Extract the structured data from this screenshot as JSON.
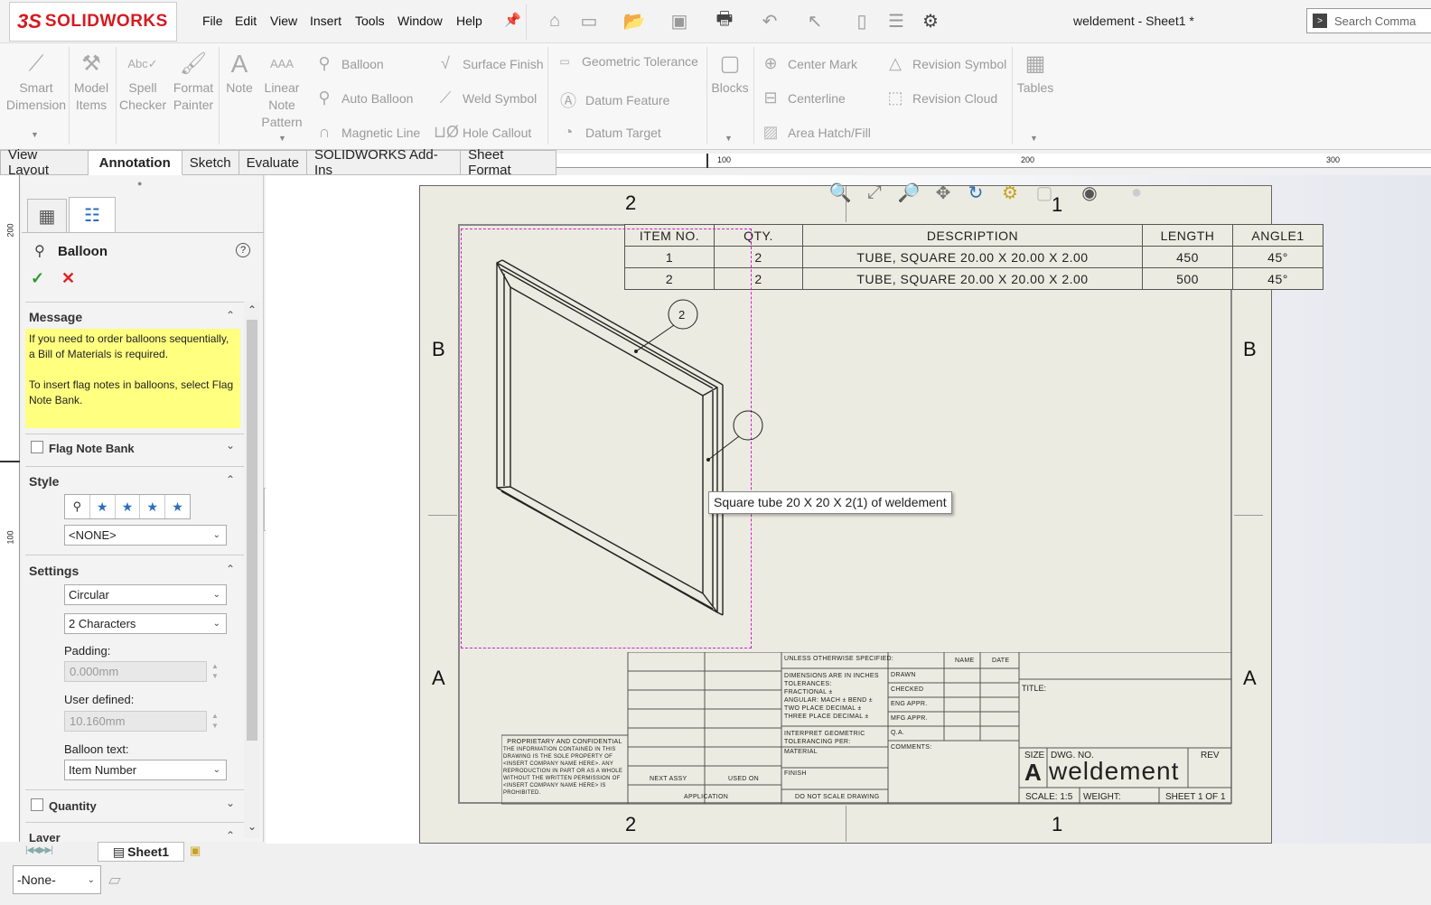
{
  "app": {
    "logo_ds": "3S",
    "logo_name": "SOLIDWORKS",
    "title": "weldement - Sheet1 *"
  },
  "menu": [
    "File",
    "Edit",
    "View",
    "Insert",
    "Tools",
    "Window",
    "Help"
  ],
  "search": {
    "placeholder": "Search Comma"
  },
  "ribbon": {
    "smart_dimension": [
      "Smart",
      "Dimension"
    ],
    "model_items": [
      "Model",
      "Items"
    ],
    "spell_checker": [
      "Spell",
      "Checker"
    ],
    "format_painter": [
      "Format",
      "Painter"
    ],
    "note": "Note",
    "linear_note_pattern": [
      "Linear",
      "Note",
      "Pattern"
    ],
    "balloon": "Balloon",
    "auto_balloon": "Auto Balloon",
    "magnetic_line": "Magnetic Line",
    "surface_finish": "Surface Finish",
    "weld_symbol": "Weld Symbol",
    "hole_callout": "Hole Callout",
    "geometric_tolerance": "Geometric Tolerance",
    "datum_feature": "Datum Feature",
    "datum_target": "Datum Target",
    "blocks": "Blocks",
    "center_mark": "Center Mark",
    "centerline": "Centerline",
    "area_hatch": "Area Hatch/Fill",
    "revision_symbol": "Revision Symbol",
    "revision_cloud": "Revision Cloud",
    "tables": "Tables"
  },
  "tabs": [
    "View Layout",
    "Annotation",
    "Sketch",
    "Evaluate",
    "SOLIDWORKS Add-Ins",
    "Sheet Format"
  ],
  "ruler": {
    "top": [
      "100",
      "200",
      "300"
    ],
    "left": [
      "200",
      "100"
    ]
  },
  "pm": {
    "title": "Balloon",
    "help": "?",
    "message_title": "Message",
    "message_1": "If you need to order balloons sequentially, a Bill of Materials is required.",
    "message_2": "To insert flag notes in balloons, select Flag Note Bank.",
    "flag_note_bank": "Flag Note Bank",
    "style_title": "Style",
    "style_value": "<NONE>",
    "settings_title": "Settings",
    "shape": "Circular",
    "size": "2 Characters",
    "padding_label": "Padding:",
    "padding_value": "0.000mm",
    "user_defined_label": "User defined:",
    "user_defined_value": "10.160mm",
    "balloon_text_label": "Balloon text:",
    "balloon_text_value": "Item Number",
    "quantity": "Quantity",
    "layer": "Layer"
  },
  "sheet_tab": "Sheet1",
  "status": {
    "layer": "-None-"
  },
  "drawing": {
    "zones_top": [
      "2",
      "1"
    ],
    "zones_side": [
      "B",
      "A"
    ],
    "bom_headers": [
      "ITEM NO.",
      "QTY.",
      "DESCRIPTION",
      "LENGTH",
      "ANGLE1"
    ],
    "bom_rows": [
      [
        "1",
        "2",
        "TUBE, SQUARE 20.00 X 20.00 X 2.00",
        "450",
        "45°"
      ],
      [
        "2",
        "2",
        "TUBE, SQUARE 20.00 X 20.00 X 2.00",
        "500",
        "45°"
      ]
    ],
    "balloon_1": "2",
    "tooltip": "Square tube 20 X 20 X 2(1) of weldement",
    "titleblock": {
      "unless": "UNLESS OTHERWISE SPECIFIED:",
      "name": "NAME",
      "date": "DATE",
      "dims": "DIMENSIONS ARE IN INCHES",
      "tol": "TOLERANCES:",
      "frac": "FRACTIONAL ±",
      "ang": "ANGULAR: MACH ±   BEND ±",
      "two": "TWO PLACE DECIMAL   ±",
      "three": "THREE PLACE DECIMAL  ±",
      "interp": "INTERPRET GEOMETRIC",
      "tolper": "TOLERANCING PER:",
      "material": "MATERIAL",
      "finish": "FINISH",
      "drawn": "DRAWN",
      "checked": "CHECKED",
      "engappr": "ENG APPR.",
      "mfgappr": "MFG APPR.",
      "qa": "Q.A.",
      "comments": "COMMENTS:",
      "title": "TITLE:",
      "prop": "PROPRIETARY AND CONFIDENTIAL",
      "prop_text": "THE INFORMATION CONTAINED IN THIS DRAWING IS THE SOLE PROPERTY OF <INSERT COMPANY NAME HERE>. ANY REPRODUCTION IN PART OR AS A WHOLE WITHOUT THE WRITTEN PERMISSION OF <INSERT COMPANY NAME HERE> IS PROHIBITED.",
      "next_assy": "NEXT ASSY",
      "used_on": "USED ON",
      "application": "APPLICATION",
      "do_not_scale": "DO NOT SCALE DRAWING",
      "size_label": "SIZE",
      "dwg_no_label": "DWG.  NO.",
      "rev_label": "REV",
      "size_value": "A",
      "dwg_no_value": "weldement",
      "scale": "SCALE: 1:5",
      "weight": "WEIGHT:",
      "sheet": "SHEET 1 OF 1"
    }
  }
}
